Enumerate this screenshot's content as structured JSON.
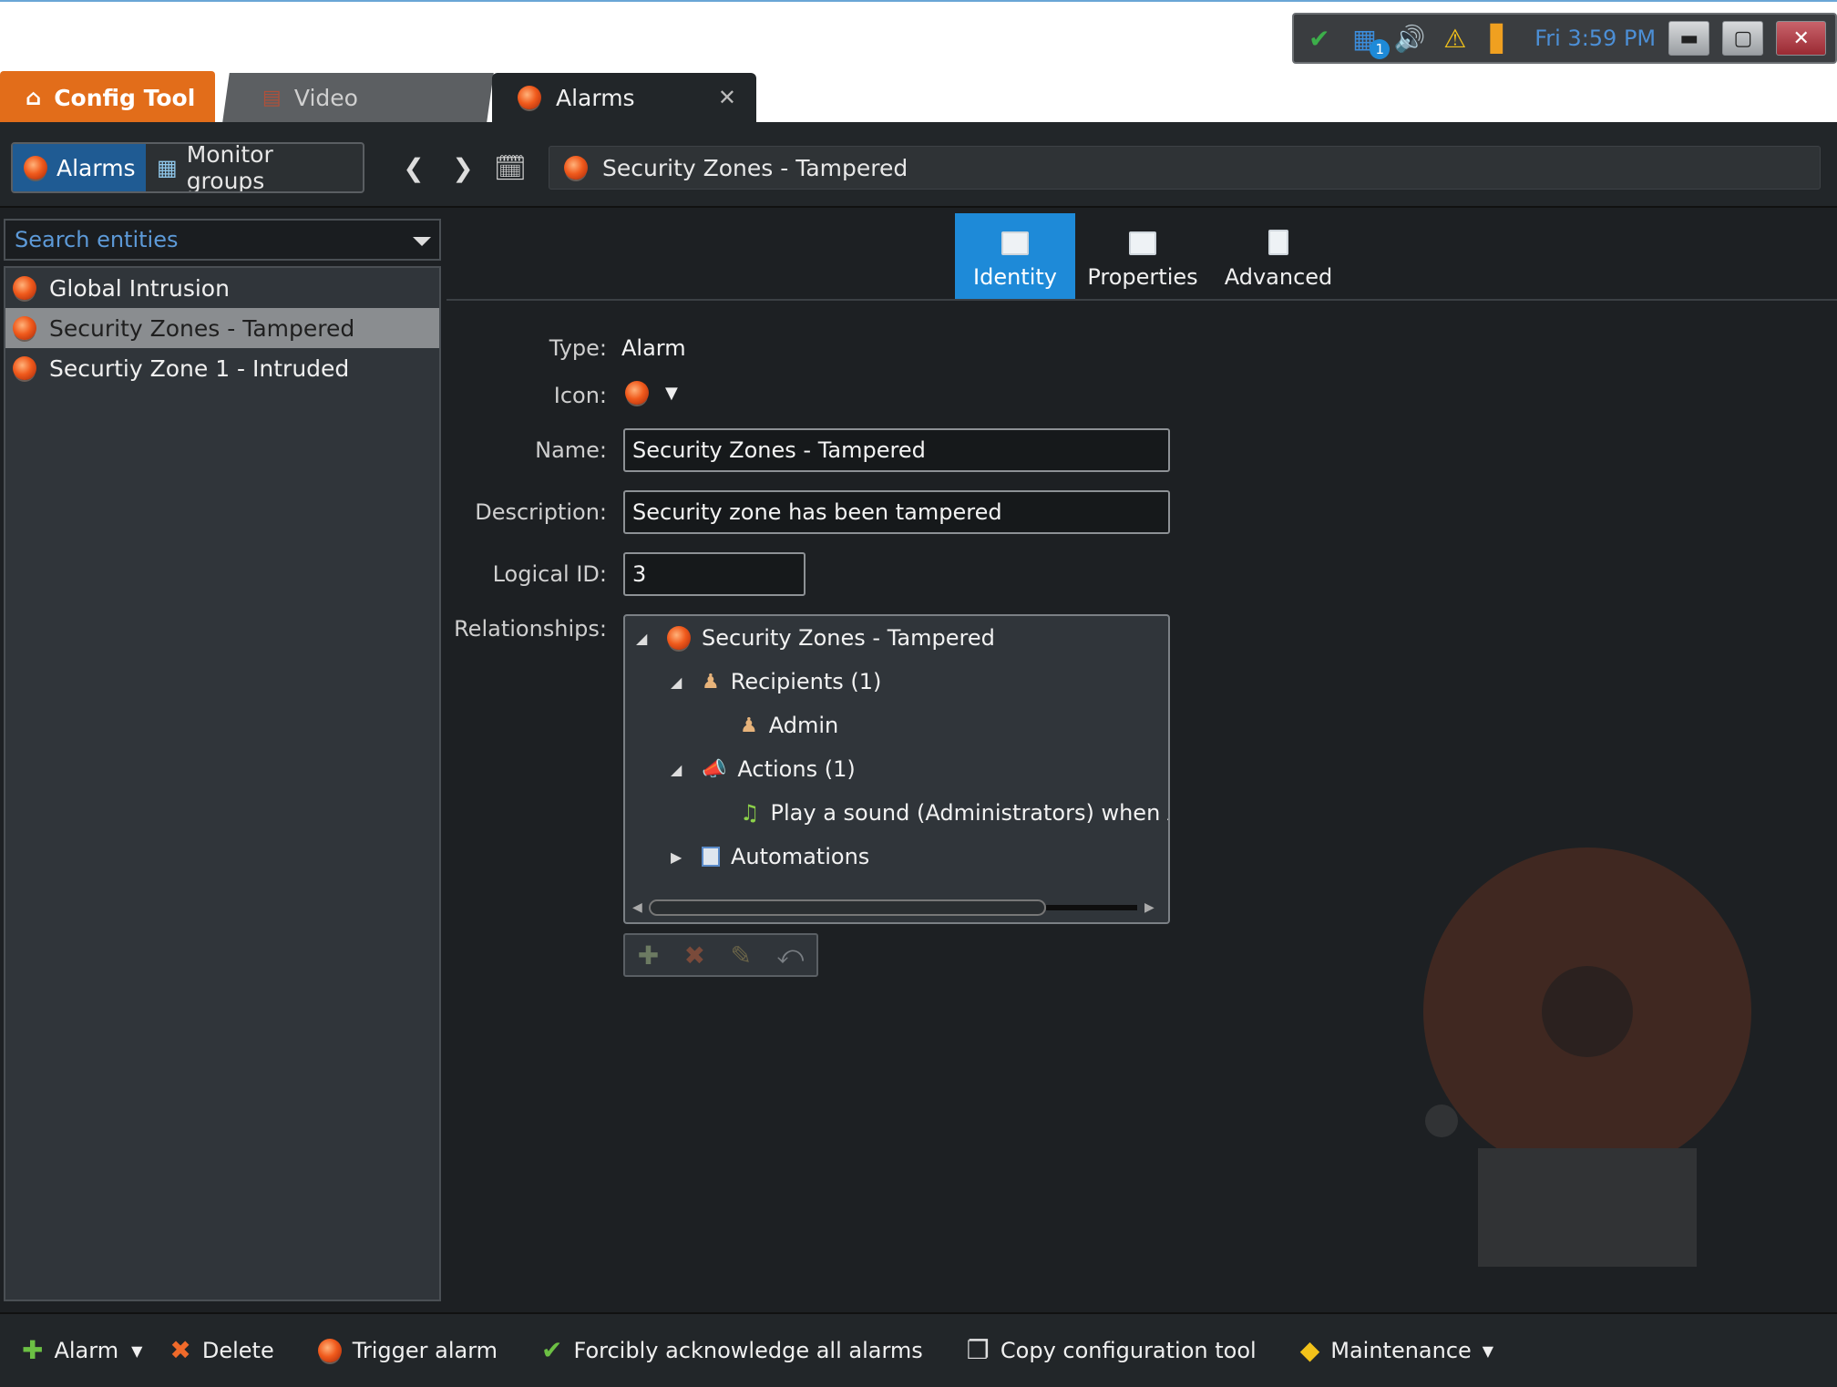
{
  "sysbar": {
    "network_badge": "1",
    "time": "Fri 3:59 PM"
  },
  "tabs": {
    "config_tool": "Config Tool",
    "video": "Video",
    "alarms": "Alarms"
  },
  "toolbar": {
    "seg_alarms": "Alarms",
    "seg_monitor_groups": "Monitor groups",
    "breadcrumb": "Security Zones - Tampered"
  },
  "sidebar": {
    "search_placeholder": "Search entities",
    "items": [
      {
        "label": "Global Intrusion"
      },
      {
        "label": "Security Zones - Tampered"
      },
      {
        "label": "Securtiy Zone 1 - Intruded"
      }
    ]
  },
  "content_tabs": {
    "identity": "Identity",
    "properties": "Properties",
    "advanced": "Advanced"
  },
  "form": {
    "type_label": "Type:",
    "type_value": "Alarm",
    "icon_label": "Icon:",
    "name_label": "Name:",
    "name_value": "Security Zones - Tampered",
    "description_label": "Description:",
    "description_value": "Security zone has been tampered",
    "logical_id_label": "Logical ID:",
    "logical_id_value": "3",
    "relationships_label": "Relationships:"
  },
  "relationships": {
    "root": "Security Zones - Tampered",
    "recipients": "Recipients (1)",
    "admin": "Admin",
    "actions": "Actions (1)",
    "play_sound": "Play a sound (Administrators) when Alarm",
    "automations": "Automations"
  },
  "bottombar": {
    "alarm": "Alarm",
    "delete": "Delete",
    "trigger_alarm": "Trigger alarm",
    "force_ack": "Forcibly acknowledge all alarms",
    "copy_config": "Copy configuration tool",
    "maintenance": "Maintenance"
  },
  "colors": {
    "accent_blue": "#1e8ad8",
    "config_orange": "#e26d1a",
    "background": "#1d2023"
  }
}
